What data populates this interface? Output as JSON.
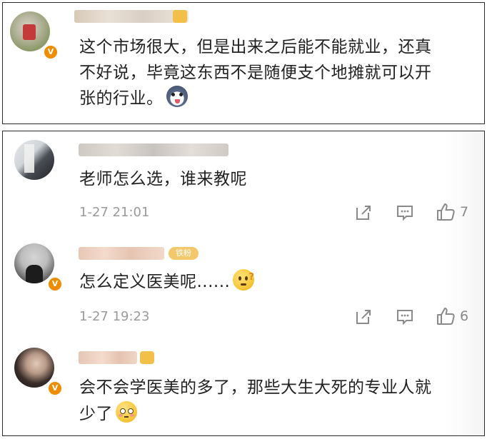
{
  "top_post": {
    "line1": "这个市场很大，但是出来之后能不能就业，还真",
    "line2": "不好说，毕竟这东西不是随便支个地摊就可以开",
    "line3": "张的行业。",
    "emoji": "husky-emoji"
  },
  "comments": [
    {
      "text": "老师怎么选，谁来教呢",
      "time": "1-27 21:01",
      "likes": "7"
    },
    {
      "text": "怎么定义医美呢......",
      "time": "1-27 19:23",
      "likes": "6",
      "emoji": "thinking-emoji",
      "badge": "铁粉"
    },
    {
      "text_line1": "会不会学医美的多了，那些大生大死的专业人就",
      "text_line2": "少了",
      "emoji": "flushed-emoji"
    }
  ],
  "colors": {
    "verified_badge": "#f08c00",
    "meta_text": "#9a9a9a"
  }
}
